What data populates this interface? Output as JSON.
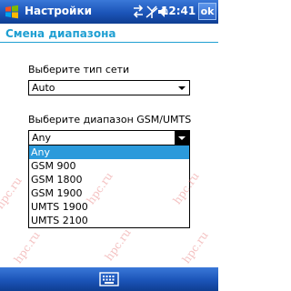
{
  "titlebar": {
    "title": "Настройки",
    "time": "12:41",
    "ok_label": "ok",
    "icons": [
      "connectivity-icon",
      "signal-off-icon",
      "volume-icon"
    ]
  },
  "page": {
    "header": "Смена диапазона"
  },
  "network_type": {
    "label": "Выберите тип сети",
    "value": "Auto"
  },
  "band": {
    "label": "Выберите диапазон GSM/UMTS",
    "value": "Any",
    "options": [
      "Any",
      "GSM 900",
      "GSM 1800",
      "GSM 1900",
      "UMTS 1900",
      "UMTS 2100"
    ],
    "selected_index": 0
  },
  "watermark": "hpc.ru",
  "colors": {
    "accent": "#1f9fd2",
    "titlebar": "#1b54b8",
    "selection": "#2b9adb"
  }
}
